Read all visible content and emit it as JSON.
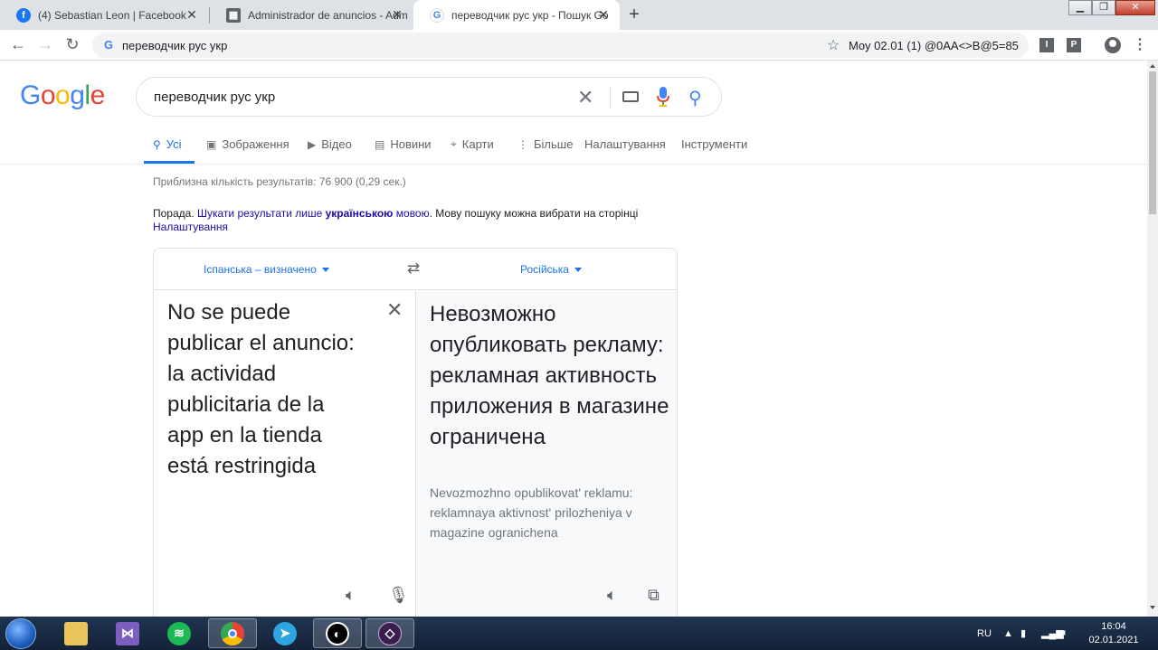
{
  "browser": {
    "tabs": [
      {
        "title": "(4) Sebastian Leon | Facebook",
        "icon": "facebook-icon"
      },
      {
        "title": "Administrador de anuncios - Adm",
        "icon": "ads-manager-icon"
      },
      {
        "title": "переводчик рус укр - Пошук Go",
        "icon": "google-icon"
      }
    ],
    "address": "переводчик рус укр",
    "bookmark_text": "Moy 02.01 (1) @0AA<>B@5=85",
    "ext1": "I",
    "ext2": "P"
  },
  "search": {
    "query": "переводчик рус укр"
  },
  "nav_tabs": [
    {
      "label": "Усі"
    },
    {
      "label": "Зображення"
    },
    {
      "label": "Відео"
    },
    {
      "label": "Новини"
    },
    {
      "label": "Карти"
    },
    {
      "label": "Більше"
    },
    {
      "label": "Налаштування"
    },
    {
      "label": "Інструменти"
    }
  ],
  "results": {
    "stats": "Приблизна кількість результатів: 76 900 (0,29 сек.)",
    "tip_prefix": "Порада.",
    "tip_link1": "Шукати результати лише",
    "tip_bold": "українською",
    "tip_link2": "мовою",
    "tip_suffix": ". Мову пошуку можна вибрати на сторінці",
    "tip_settings": "Налаштування"
  },
  "translator": {
    "source_lang": "Іспанська – визначено",
    "target_lang": "Російська",
    "source_text": "No se puede publicar el anuncio: la actividad publicitaria de la app en la tienda está restringida",
    "target_text": "Невозможно опубликовать рекламу: рекламная активность приложения в магазине ограничена",
    "transliteration": "Nevozmozhno opublikovat' reklamu: reklamnaya aktivnost' prilozheniya v magazine ogranichena"
  },
  "taskbar": {
    "lang": "RU",
    "time": "16:04",
    "date": "02.01.2021"
  },
  "colors": {
    "link": "#1a0dab",
    "accent": "#1a73e8"
  }
}
